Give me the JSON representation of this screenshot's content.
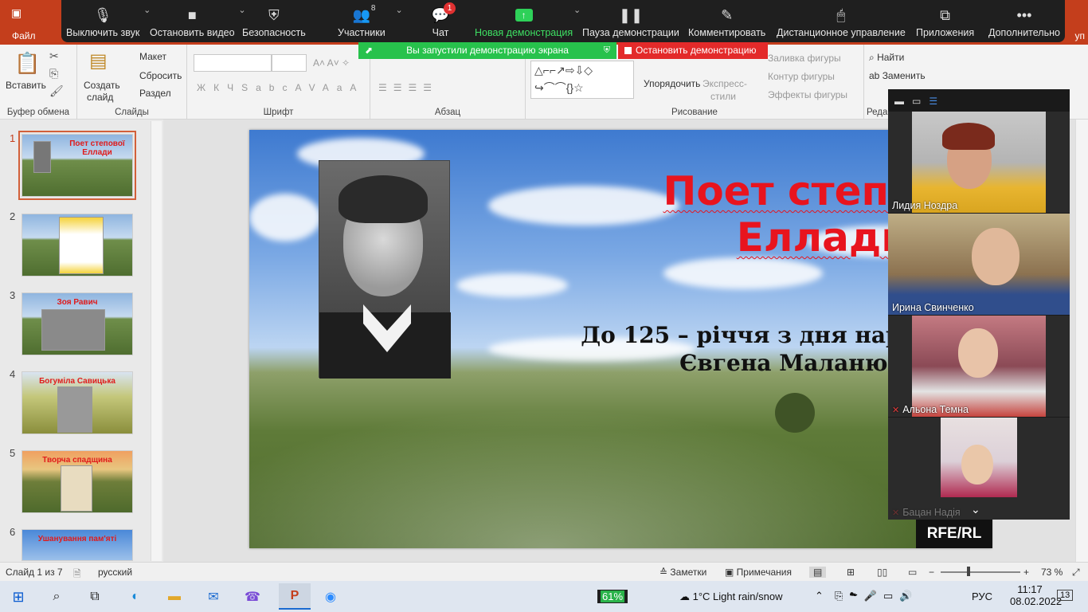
{
  "powerpoint": {
    "file_tab": "Файл",
    "share_suffix": "уп",
    "groups": {
      "clipboard": "Буфер обмена",
      "slides": "Слайды",
      "font": "Шрифт",
      "paragraph": "Абзац",
      "drawing": "Рисование",
      "editing": "Реда"
    },
    "buttons": {
      "paste": "Вставить",
      "new_slide_1": "Создать",
      "new_slide_2": "слайд",
      "layout": "Макет",
      "reset": "Сбросить",
      "section": "Раздел",
      "arrange": "Упорядочить",
      "quick_styles_1": "Экспресс-",
      "quick_styles_2": "стили",
      "shape_fill": "Заливка фигуры",
      "shape_outline": "Контур фигуры",
      "shape_effects": "Эффекты фигуры",
      "find": "Найти",
      "replace": "Заменить"
    },
    "font_buttons": [
      "Ж",
      "К",
      "Ч",
      "S",
      "abc",
      "AV",
      "Aa",
      "A"
    ]
  },
  "zoom_toolbar": {
    "items": [
      {
        "label": "Выключить звук",
        "icon": "microphone-icon"
      },
      {
        "label": "Остановить видео",
        "icon": "video-camera-icon"
      },
      {
        "label": "Безопасность",
        "icon": "shield-icon"
      },
      {
        "label": "Участники",
        "icon": "participants-icon",
        "count": "8"
      },
      {
        "label": "Чат",
        "icon": "chat-icon",
        "badge": "1"
      },
      {
        "label": "Новая демонстрация",
        "icon": "share-screen-icon"
      },
      {
        "label": "Пауза демонстрации",
        "icon": "pause-icon"
      },
      {
        "label": "Комментировать",
        "icon": "pencil-icon"
      },
      {
        "label": "Дистанционное управление",
        "icon": "mouse-icon"
      },
      {
        "label": "Приложения",
        "icon": "apps-icon"
      },
      {
        "label": "Дополнительно",
        "icon": "more-icon"
      }
    ],
    "share_banner": "Вы запустили демонстрацию экрана",
    "stop_share": "Остановить демонстрацию",
    "accent_green": "#27c24c",
    "accent_red": "#e32a2a"
  },
  "thumbnails": [
    {
      "num": "1",
      "title": "Поет степової Еллади"
    },
    {
      "num": "2",
      "title": ""
    },
    {
      "num": "3",
      "title": "Зоя Равич"
    },
    {
      "num": "4",
      "title": "Богуміла Савицька"
    },
    {
      "num": "5",
      "title": "Творча спадщина"
    },
    {
      "num": "6",
      "title": "Ушанування пам'яті"
    }
  ],
  "slide": {
    "title_line1": "Поет степової",
    "title_line2": "Еллади",
    "subtitle_line1": "До 125 – річчя з дня народження",
    "subtitle_line2": "Євгена Маланюка",
    "title_color": "#e8141e",
    "watermark": "RFE/RL"
  },
  "participants": [
    {
      "name": "Лидия Ноздра",
      "muted": false
    },
    {
      "name": "Ирина Свинченко",
      "muted": false
    },
    {
      "name": "Альона Темна",
      "muted": true
    },
    {
      "name": "Бацан Надія",
      "muted": true
    }
  ],
  "statusbar": {
    "slide_info": "Слайд 1 из 7",
    "language": "русский",
    "notes": "Заметки",
    "comments": "Примечания",
    "zoom": "73 %"
  },
  "taskbar": {
    "battery": "61%",
    "weather": "1°C  Light rain/snow",
    "lang": "РУС",
    "time": "11:17",
    "date": "08.02.2022",
    "notifications": "13"
  }
}
